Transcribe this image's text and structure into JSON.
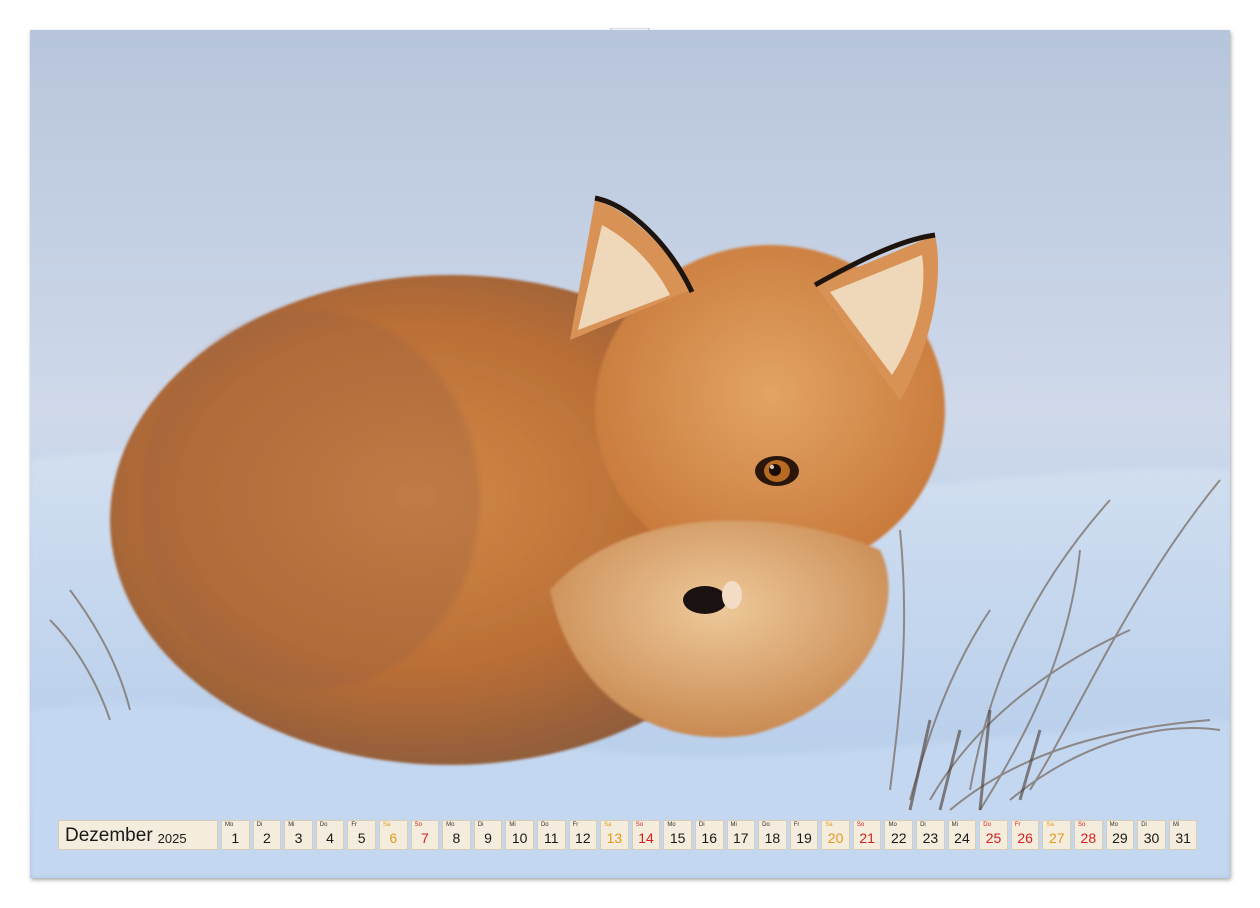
{
  "calendar": {
    "month": "Dezember",
    "year": "2025",
    "days": [
      {
        "wd": "Mo",
        "num": "1",
        "kind": "weekday"
      },
      {
        "wd": "Di",
        "num": "2",
        "kind": "weekday"
      },
      {
        "wd": "Mi",
        "num": "3",
        "kind": "weekday"
      },
      {
        "wd": "Do",
        "num": "4",
        "kind": "weekday"
      },
      {
        "wd": "Fr",
        "num": "5",
        "kind": "weekday"
      },
      {
        "wd": "Sa",
        "num": "6",
        "kind": "sat"
      },
      {
        "wd": "So",
        "num": "7",
        "kind": "sun"
      },
      {
        "wd": "Mo",
        "num": "8",
        "kind": "weekday"
      },
      {
        "wd": "Di",
        "num": "9",
        "kind": "weekday"
      },
      {
        "wd": "Mi",
        "num": "10",
        "kind": "weekday"
      },
      {
        "wd": "Do",
        "num": "11",
        "kind": "weekday"
      },
      {
        "wd": "Fr",
        "num": "12",
        "kind": "weekday"
      },
      {
        "wd": "Sa",
        "num": "13",
        "kind": "sat"
      },
      {
        "wd": "So",
        "num": "14",
        "kind": "sun"
      },
      {
        "wd": "Mo",
        "num": "15",
        "kind": "weekday"
      },
      {
        "wd": "Di",
        "num": "16",
        "kind": "weekday"
      },
      {
        "wd": "Mi",
        "num": "17",
        "kind": "weekday"
      },
      {
        "wd": "Do",
        "num": "18",
        "kind": "weekday"
      },
      {
        "wd": "Fr",
        "num": "19",
        "kind": "weekday"
      },
      {
        "wd": "Sa",
        "num": "20",
        "kind": "sat"
      },
      {
        "wd": "So",
        "num": "21",
        "kind": "sun"
      },
      {
        "wd": "Mo",
        "num": "22",
        "kind": "weekday"
      },
      {
        "wd": "Di",
        "num": "23",
        "kind": "weekday"
      },
      {
        "wd": "Mi",
        "num": "24",
        "kind": "weekday"
      },
      {
        "wd": "Do",
        "num": "25",
        "kind": "hol"
      },
      {
        "wd": "Fr",
        "num": "26",
        "kind": "hol"
      },
      {
        "wd": "Sa",
        "num": "27",
        "kind": "sat"
      },
      {
        "wd": "So",
        "num": "28",
        "kind": "sun"
      },
      {
        "wd": "Mo",
        "num": "29",
        "kind": "weekday"
      },
      {
        "wd": "Di",
        "num": "30",
        "kind": "weekday"
      },
      {
        "wd": "Mi",
        "num": "31",
        "kind": "weekday"
      }
    ]
  },
  "colors": {
    "saturday": "#e39a1c",
    "sunday_holiday": "#d42020",
    "cell_background": "#f4ecdc",
    "snow": "#c9d9ee",
    "fox_fur": "#c9783a"
  },
  "icons": {
    "binding": "wire-binding-holes",
    "hanger": "calendar-hanger-notch"
  }
}
